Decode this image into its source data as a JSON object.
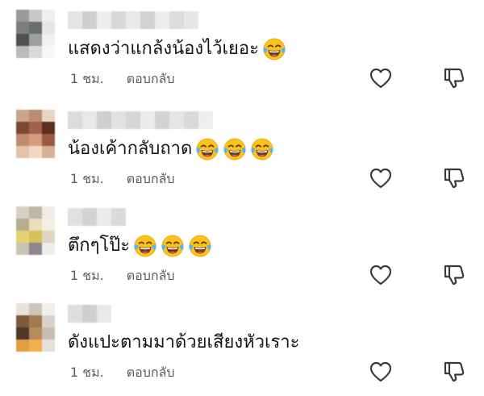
{
  "comments": [
    {
      "text": "แสดงว่าแกล้งน้องไว้เยอะ",
      "emoji": [
        "face-with-tears-of-joy"
      ],
      "time": "1 ชม.",
      "reply_label": "ตอบกลับ",
      "avatar_colors": [
        "#9a9a9a",
        "#c8c8c8",
        "#efefef",
        "#7d7d7d",
        "#6a6f6c",
        "#e6e6e6",
        "#4d5250",
        "#9ea09e",
        "#f1f1f1",
        "#b9bcba",
        "#d9dad9",
        "#f7f7f7"
      ],
      "name_colors": [
        "#e3e3e3",
        "#cfcfcf",
        "#ededed",
        "#d8d8d8",
        "#e8e8e8",
        "#d2d2d2",
        "#ececec",
        "#dcdcdc",
        "#e6e6e6"
      ]
    },
    {
      "text": "น้องเค้ากลับถาด",
      "emoji": [
        "face-with-tears-of-joy",
        "face-with-tears-of-joy",
        "face-with-tears-of-joy"
      ],
      "time": "1 ชม.",
      "reply_label": "ตอบกลับ",
      "avatar_colors": [
        "#c9a58e",
        "#b98d6f",
        "#e9d5c6",
        "#7a4a32",
        "#a0624a",
        "#5a3020",
        "#c08a6e",
        "#d79c7c",
        "#9c5a3e",
        "#e4c2aa",
        "#f0d8c6",
        "#d8b098"
      ],
      "name_colors": [
        "#dcdcdc",
        "#e8e8e8",
        "#cfcfcf",
        "#e2e2e2",
        "#d6d6d6",
        "#ebebeb",
        "#d3d3d3",
        "#e5e5e5",
        "#dadada",
        "#eeeeee"
      ]
    },
    {
      "text": "ตึกๆโป๊ะ",
      "emoji": [
        "face-with-tears-of-joy",
        "face-with-tears-of-joy",
        "face-with-tears-of-joy"
      ],
      "time": "1 ชม.",
      "reply_label": "ตอบกลับ",
      "avatar_colors": [
        "#d4d0c4",
        "#bdb7a8",
        "#efece5",
        "#b6ae8e",
        "#e9dfb9",
        "#f3efe2",
        "#e6d274",
        "#d9c15a",
        "#ddd7c2",
        "#c9c3b0",
        "#8e8793",
        "#efede8"
      ],
      "name_colors": [
        "#e0e0e0",
        "#d3d3d3",
        "#ebebeb",
        "#dadada"
      ]
    },
    {
      "text": "ดังแปะตามมาด้วยเสียงหัวเราะ",
      "emoji": [],
      "time": "1 ชม.",
      "reply_label": "ตอบกลับ",
      "avatar_colors": [
        "#e8e2da",
        "#cfc4b8",
        "#f2efea",
        "#7c5a3e",
        "#a37a52",
        "#d9d2ca",
        "#4e3a2c",
        "#b58a5c",
        "#c7beb4",
        "#e0a040",
        "#f0b050",
        "#e6e0d8"
      ],
      "name_colors": [
        "#dedede",
        "#cfcfcf",
        "#e9e9e9"
      ]
    }
  ],
  "icons": {
    "like": "heart-outline-icon",
    "dislike": "thumbs-down-icon"
  }
}
